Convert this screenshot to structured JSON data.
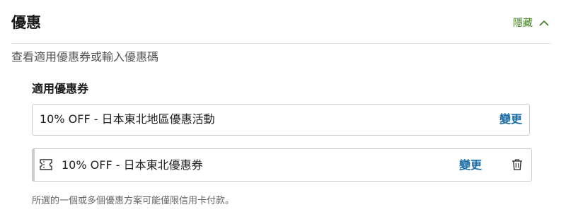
{
  "section": {
    "title": "優惠",
    "hide_label": "隱藏",
    "subtitle": "查看適用優惠券或輸入優惠碼"
  },
  "applied": {
    "heading": "適用優惠券",
    "campaign": {
      "text": "10% OFF - 日本東北地區優惠活動",
      "change_label": "變更"
    },
    "coupon": {
      "text": "10% OFF - 日本東北優惠券",
      "change_label": "變更"
    }
  },
  "footnote": "所選的一個或多個優惠方案可能僅限信用卡付款。",
  "colors": {
    "accent_green": "#3e7a1f",
    "link_blue": "#1f6fa6",
    "border": "#cccccc"
  },
  "icons": {
    "hide_toggle": "chevron-up-icon",
    "coupon": "ticket-icon",
    "remove": "trash-icon"
  }
}
